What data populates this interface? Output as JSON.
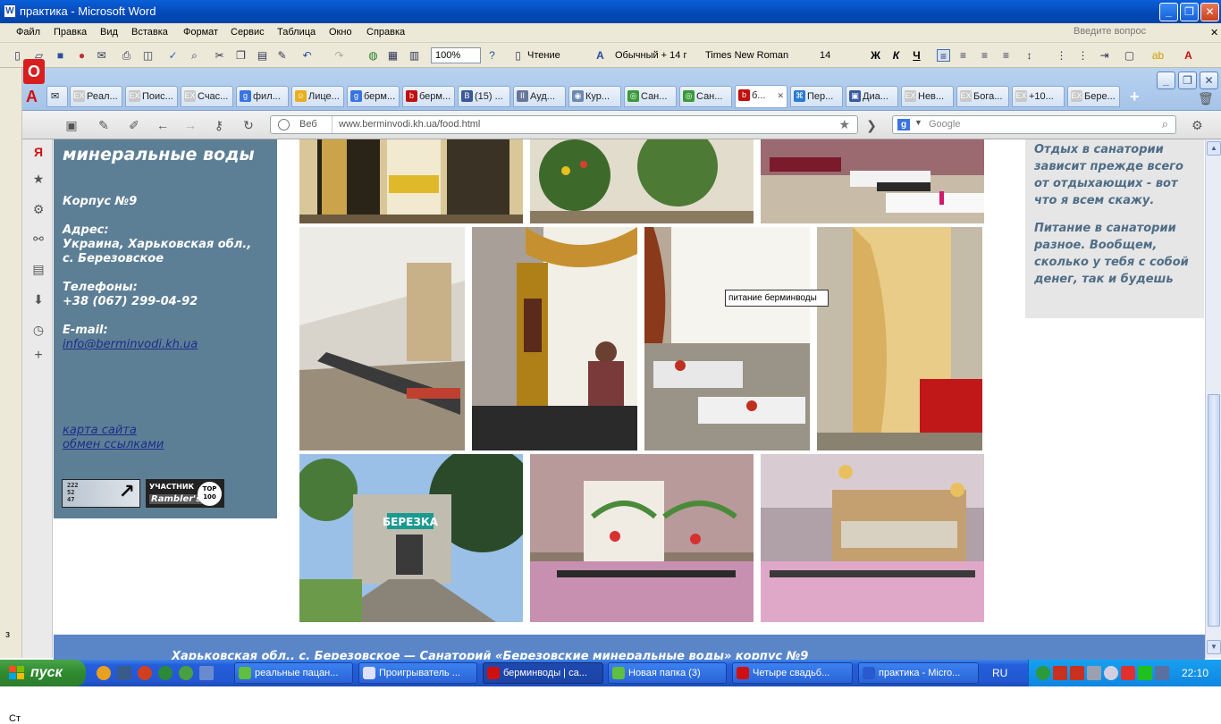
{
  "word": {
    "title": "практика - Microsoft Word",
    "menu": [
      "Файл",
      "Правка",
      "Вид",
      "Вставка",
      "Формат",
      "Сервис",
      "Таблица",
      "Окно",
      "Справка"
    ],
    "ask_placeholder": "Введите вопрос",
    "zoom": "100%",
    "read_label": "Чтение",
    "style": "Обычный + 14 г",
    "font": "Times New Roman",
    "size": "14",
    "bold": "Ж",
    "italic": "К",
    "underline": "Ч",
    "side_label_top": "з",
    "side_label_bottom": "Ст"
  },
  "browser": {
    "tabs": [
      {
        "label": "Реал...",
        "icon": "EX",
        "color": "#c8c8c8"
      },
      {
        "label": "Поис...",
        "icon": "EX",
        "color": "#c8c8c8"
      },
      {
        "label": "Счас...",
        "icon": "EX",
        "color": "#c8c8c8"
      },
      {
        "label": "фил...",
        "icon": "g",
        "color": "#3a74e0"
      },
      {
        "label": "Лице...",
        "icon": "☺",
        "color": "#e8b020"
      },
      {
        "label": "берм...",
        "icon": "g",
        "color": "#3a74e0"
      },
      {
        "label": "берм...",
        "icon": "b",
        "color": "#c01010"
      },
      {
        "label": "(15) ...",
        "icon": "B",
        "color": "#3b5998"
      },
      {
        "label": "Ауд...",
        "icon": "II",
        "color": "#667799"
      },
      {
        "label": "Кур...",
        "icon": "◉",
        "color": "#6b8ab0"
      },
      {
        "label": "Сан...",
        "icon": "◎",
        "color": "#3a9a3a"
      },
      {
        "label": "Сан...",
        "icon": "◎",
        "color": "#3a9a3a"
      },
      {
        "label": "б...",
        "icon": "b",
        "color": "#c01010",
        "active": true
      },
      {
        "label": "Пер...",
        "icon": "⌘",
        "color": "#2a7ad0"
      },
      {
        "label": "Диа...",
        "icon": "▣",
        "color": "#3a5aa0"
      },
      {
        "label": "Нев...",
        "icon": "EX",
        "color": "#c8c8c8"
      },
      {
        "label": "Бога...",
        "icon": "EX",
        "color": "#c8c8c8"
      },
      {
        "label": "+10...",
        "icon": "EX",
        "color": "#c8c8c8"
      },
      {
        "label": "Бере...",
        "icon": "EX",
        "color": "#c8c8c8"
      }
    ],
    "web_label": "Веб",
    "url": "www.berminvodi.kh.ua/food.html",
    "search_engine": "g",
    "search_placeholder": "Google"
  },
  "site": {
    "heading": "минеральные воды",
    "building": "Корпус №9",
    "address_label": "Адрес:",
    "address_line1": "Украина, Харьковская обл.,",
    "address_line2": "с. Березовское",
    "phones_label": "Телефоны:",
    "phone": "+38 (067) 299-04-92",
    "email_label": "E-mail:",
    "email": "info@berminvodi.kh.ua",
    "link_map": "карта сайта",
    "link_exchange": "обмен ссылками",
    "counter_digits": "222\n52\n47",
    "rambler_top": "УЧАСТНИК",
    "rambler_name": "Rambler's",
    "rambler_badge": "TOP 100",
    "right_p1": "Отдых в санатории зависит прежде всего от отдыхающих - вот что я всем скажу.",
    "right_p2": "Питание в санатории разное. Вообщем, сколько у тебя с собой денег, так и будешь",
    "tooltip": "питание берминводы",
    "photo_sign": "БЕРЕЗКА",
    "footer": "Харьковская обл., с. Березовское — Санаторий «Березовские минеральные воды» корпус №9"
  },
  "taskbar": {
    "start": "пуск",
    "tasks": [
      {
        "label": "реальные пацан...",
        "color": "#5fbf40"
      },
      {
        "label": "Проигрыватель ...",
        "color": "#e0e0ff"
      },
      {
        "label": "берминводы | са...",
        "color": "#d01010",
        "active": true
      },
      {
        "label": "Новая папка (3)",
        "color": "#5fbf40"
      },
      {
        "label": "Четыре свадьб...",
        "color": "#d01010"
      },
      {
        "label": "практика - Micro...",
        "color": "#2a5ad0"
      }
    ],
    "lang": "RU",
    "clock": "22:10"
  }
}
